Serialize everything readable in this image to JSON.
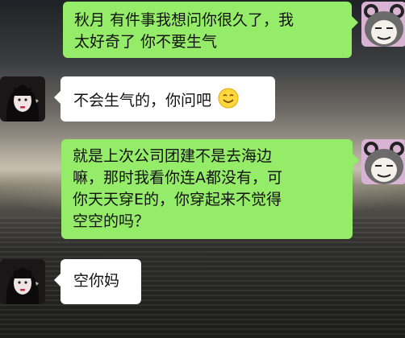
{
  "chat": {
    "messages": [
      {
        "sender": "me",
        "lines": [
          "秋月 有件事我想问你很久了，我",
          "太好奇了 你不要生气"
        ]
      },
      {
        "sender": "other",
        "text": "不会生气的，你问吧",
        "emoji": "smile-emoji"
      },
      {
        "sender": "me",
        "lines": [
          "就是上次公司团建不是去海边",
          "嘛，那时我看你连A都没有，可",
          "你天天穿E的，你穿起来不觉得",
          "空空的吗？"
        ]
      },
      {
        "sender": "other",
        "text": "空你妈"
      }
    ]
  },
  "colors": {
    "my_bubble": "#95ec69",
    "their_bubble": "#ffffff"
  }
}
